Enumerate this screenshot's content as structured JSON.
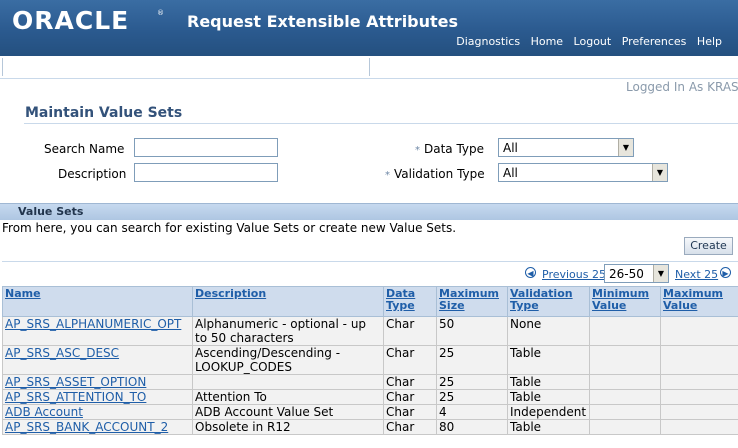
{
  "header": {
    "logo": "ORACLE",
    "registered": "®",
    "app_title": "Request Extensible Attributes",
    "links": [
      "Diagnostics",
      "Home",
      "Logout",
      "Preferences",
      "Help"
    ]
  },
  "logged_in": "Logged In As KRAS",
  "page_title": "Maintain Value Sets",
  "search": {
    "name_label": "Search Name",
    "name_value": "",
    "description_label": "Description",
    "description_value": "",
    "data_type_label": "Data Type",
    "data_type_value": "All",
    "validation_type_label": "Validation Type",
    "validation_type_value": "All",
    "required_marker": "*"
  },
  "section": {
    "title": "Value Sets",
    "instruction": "From here, you can search for existing Value Sets or create new Value Sets.",
    "create_label": "Create"
  },
  "pager": {
    "previous": "Previous 25",
    "range": "26-50",
    "next": "Next 25"
  },
  "table": {
    "columns": [
      "Name",
      "Description",
      "Data Type",
      "Maximum Size",
      "Validation Type",
      "Minimum Value",
      "Maximum Value"
    ],
    "rows": [
      [
        "AP_SRS_ALPHANUMERIC_OPT",
        "Alphanumeric - optional - up to 50 characters",
        "Char",
        "50",
        "None",
        "",
        ""
      ],
      [
        "AP_SRS_ASC_DESC",
        "Ascending/Descending - LOOKUP_CODES",
        "Char",
        "25",
        "Table",
        "",
        ""
      ],
      [
        "AP_SRS_ASSET_OPTION",
        "",
        "Char",
        "25",
        "Table",
        "",
        ""
      ],
      [
        "AP_SRS_ATTENTION_TO",
        "Attention To",
        "Char",
        "25",
        "Table",
        "",
        ""
      ],
      [
        "ADB Account",
        "ADB Account Value Set",
        "Char",
        "4",
        "Independent",
        "",
        ""
      ],
      [
        "AP_SRS_BANK_ACCOUNT_2",
        "Obsolete in R12",
        "Char",
        "80",
        "Table",
        "",
        ""
      ]
    ]
  }
}
